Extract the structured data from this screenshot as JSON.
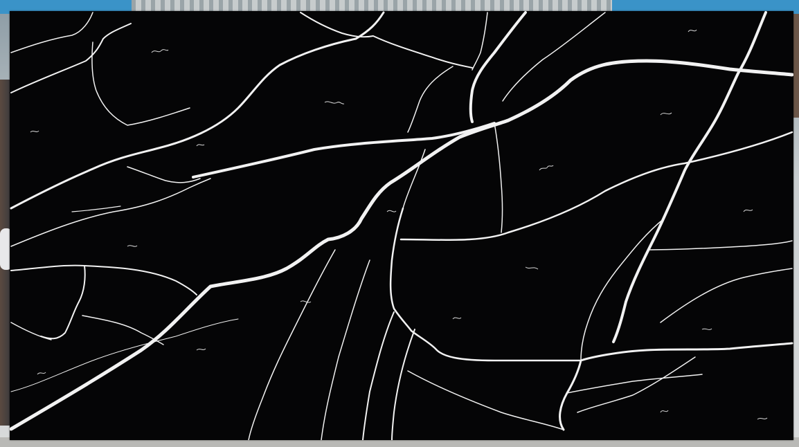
{
  "image": {
    "colors": {
      "slab": "#050506",
      "vein": "#f2f2f2",
      "backdrop_blue": "#3a93c8",
      "floor": "#b9b9b6"
    }
  }
}
